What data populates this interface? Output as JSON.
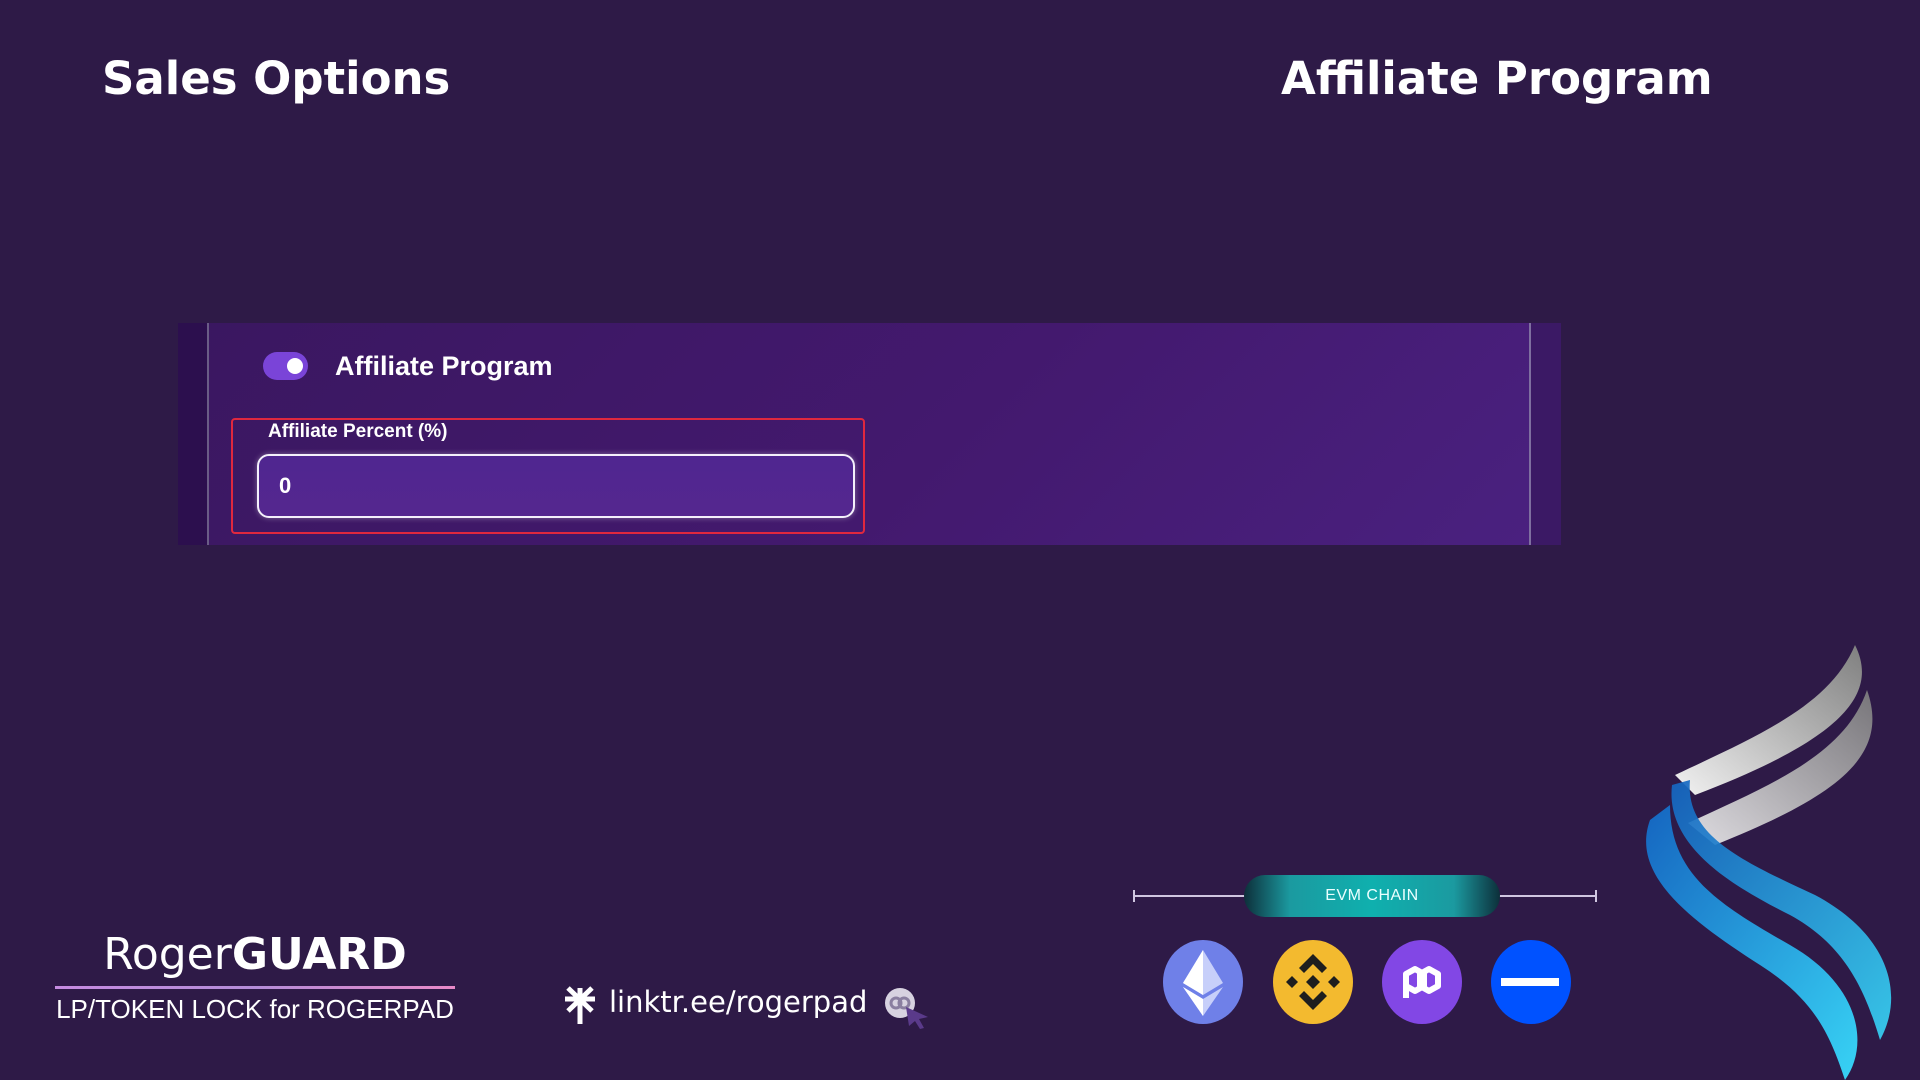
{
  "header": {
    "left_title": "Sales Options",
    "right_title": "Affiliate Program"
  },
  "panel": {
    "toggle_label": "Affiliate Program",
    "toggle_on": true,
    "field_label": "Affiliate Percent (%)",
    "field_value": "0"
  },
  "brand": {
    "name_light": "Roger",
    "name_bold": "GUARD",
    "tagline": "LP/TOKEN LOCK for ROGERPAD"
  },
  "link": {
    "text": "linktr.ee/rogerpad",
    "icon": "linktree-asterisk-icon"
  },
  "chain": {
    "badge": "EVM CHAIN",
    "networks": [
      "ethereum",
      "bnb-chain",
      "polygon",
      "base"
    ]
  },
  "colors": {
    "background": "#2e1a47",
    "panel": "#43196e",
    "toggle": "#7a44d8",
    "field_highlight": "#e0283e",
    "badge": "#0fb0ae",
    "eth": "#6f80e8",
    "bnb": "#f3ba2f",
    "polygon": "#8247e5",
    "base": "#0052ff"
  }
}
